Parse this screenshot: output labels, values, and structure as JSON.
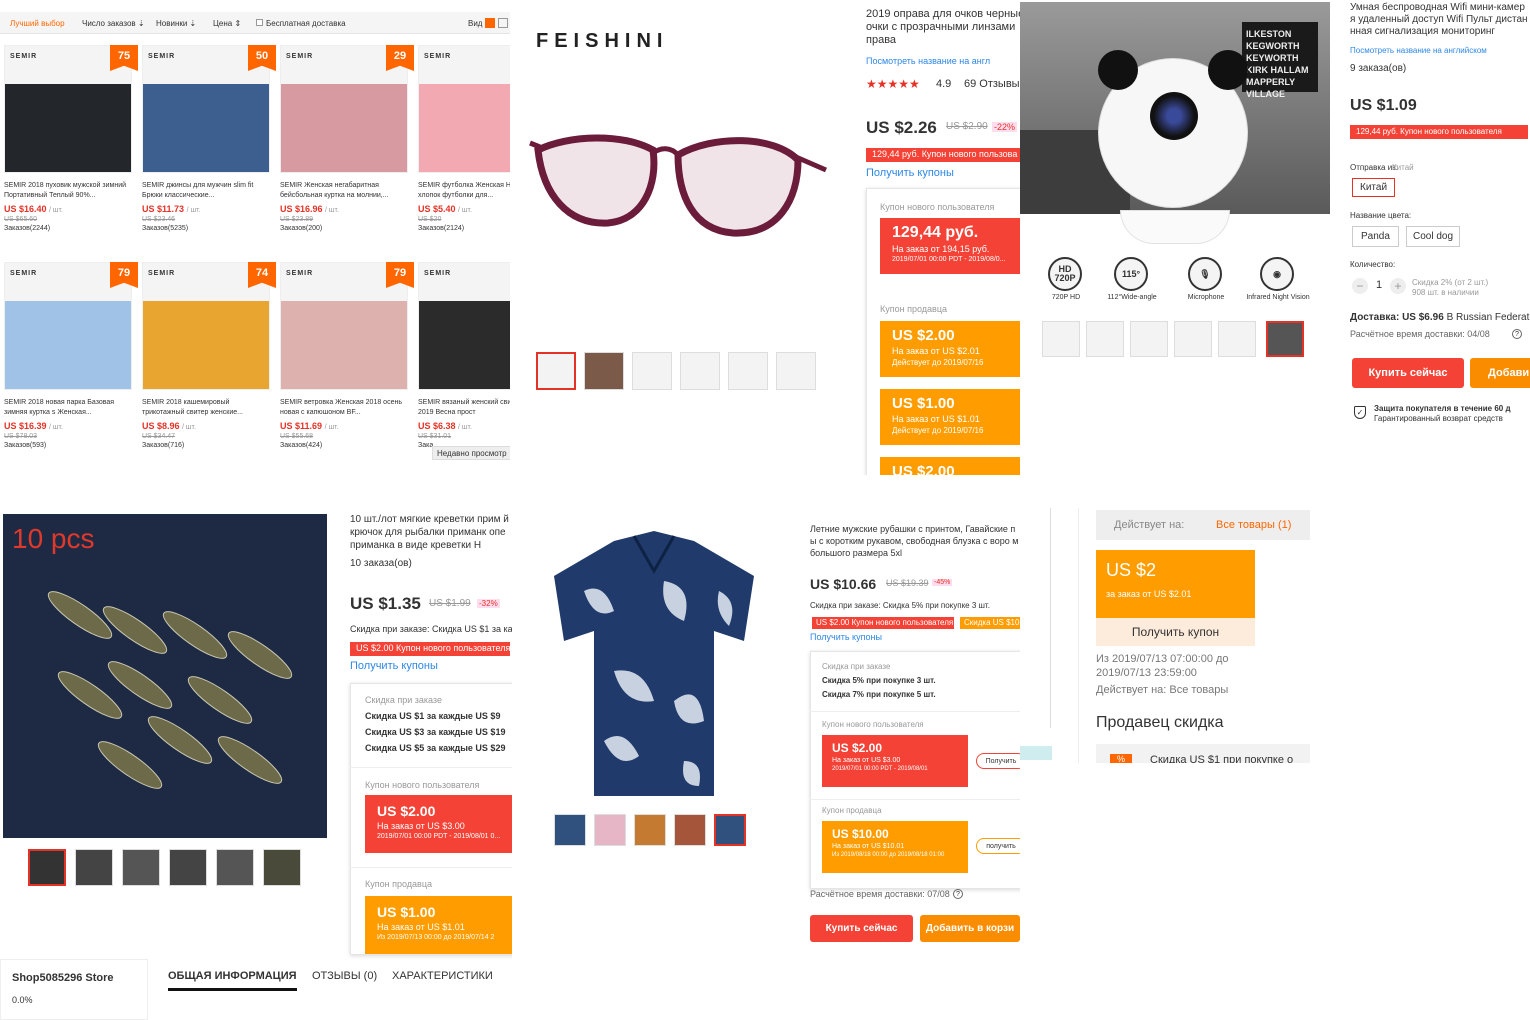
{
  "p1": {
    "sort_tabs": [
      "Лучший выбор",
      "Число заказов ⇣",
      "Новинки ⇣",
      "Цена ⇕"
    ],
    "free_shipping": "Бесплатная доставка",
    "view_label": "Вид",
    "recent": "Недавно просмотр",
    "brand": "SEMIR",
    "products": [
      {
        "badge": "75",
        "title": "SEMIR 2018 пуховик мужской зимний Портативный Теплый 90%...",
        "price": "US $16.40",
        "old": "US $65.60",
        "orders": "Заказов(2244)",
        "img": "#23262b"
      },
      {
        "badge": "50",
        "title": "SEMIR джинсы для мужчин slim fit Брюки классические...",
        "price": "US $11.73",
        "old": "US $23.46",
        "orders": "Заказов(5235)",
        "img": "#3d5f8f"
      },
      {
        "badge": "29",
        "title": "SEMIR Женская негабаритная бейсбольная куртка на молнии,...",
        "price": "US $16.96",
        "old": "US $23.89",
        "orders": "Заказов(200)",
        "img": "#d79aa0"
      },
      {
        "badge": "",
        "title": "SEMIR футболка Женская Ho 100% хлопок футболки для...",
        "price": "US $5.40",
        "old": "US $20",
        "orders": "Заказов(2124)",
        "img": "#f2a9b2"
      },
      {
        "badge": "79",
        "title": "SEMIR 2018 новая парка Базовая зимняя куртка s Женская...",
        "price": "US $16.39",
        "old": "US $78.03",
        "orders": "Заказов(593)",
        "img": "#9fc2e6"
      },
      {
        "badge": "74",
        "title": "SEMIR 2018 кашемировый трикотажный свитер женские...",
        "price": "US $8.96",
        "old": "US $34.47",
        "orders": "Заказов(716)",
        "img": "#e8a530"
      },
      {
        "badge": "79",
        "title": "SEMIR ветровка Женская 2018 осень новая с капюшоном BF...",
        "price": "US $11.69",
        "old": "US $55.68",
        "orders": "Заказов(424)",
        "img": "#dcb1ae"
      },
      {
        "badge": "",
        "title": "SEMIR вязаный женский сви кардиган 2019 Весна прост",
        "price": "US $6.38",
        "old": "US $31.01",
        "orders": "Зака",
        "img": "#2b2b2b"
      }
    ],
    "per_unit": "/ шт."
  },
  "p2": {
    "brand": "FEISHINI",
    "title": "2019 оправа для очков черные очки с прозрачными линзами права",
    "see_en": "Посмотреть название на англ",
    "rating": "4.9",
    "reviews": "69 Отзывы",
    "price": "US $2.26",
    "old": "US $2.90",
    "off": "-22%",
    "coupon_bar": "129,44 руб. Купон нового пользова",
    "get_coupons": "Получить купоны",
    "new_user_label": "Купон нового пользователя",
    "c1_amount": "129,44 руб.",
    "c1_min": "На заказ от 194,15 руб.",
    "c1_date": "2019/07/01 00:00 PDT - 2019/08/0...",
    "seller_label": "Купон продавца",
    "c2_amount": "US $2.00",
    "c2_min": "На заказ от US $2.01",
    "c2_date": "Действует до 2019/07/16",
    "c3_amount": "US $1.00",
    "c3_min": "На заказ от US $1.01",
    "c3_date": "Действует до 2019/07/16",
    "c4_amount": "US $2.00"
  },
  "p3": {
    "art": [
      "ILKESTON",
      "KEGWORTH",
      "KEYWORTH",
      "KIRK HALLAM",
      "MAPPERLY VILLAGE"
    ],
    "features": [
      {
        "icon": "HD 720P",
        "label": "720P HD"
      },
      {
        "icon": "115°",
        "label": "112°Wide-angle"
      },
      {
        "icon": "mic",
        "label": "Microphone"
      },
      {
        "icon": "eye",
        "label": "Infrared Night Vision"
      }
    ]
  },
  "p4": {
    "title": "Умная беспроводная Wifi мини-камер я удаленный доступ Wifi Пульт дистан нная сигнализация мониторинг",
    "see_en": "Посмотреть название на английском",
    "orders": "9 заказа(ов)",
    "price": "US $1.09",
    "coupon_bar": "129,44 руб. Купон нового пользователя",
    "ship_from_label": "Отправка из:",
    "ship_from_value": "Китай",
    "ship_from_option": "Китай",
    "color_label": "Название цвета:",
    "color_options": [
      "Panda",
      "Cool dog"
    ],
    "qty_label": "Количество:",
    "qty": "1",
    "qty_minus": "−",
    "qty_plus": "+",
    "qty_note1": "Скидка 2% (от 2 шт.)",
    "qty_note2": "908 шт. в наличии",
    "delivery": "Доставка:",
    "delivery_price": "US $6.96",
    "delivery_to": "В Russian Federati",
    "est_delivery": "Расчётное время доставки: 04/08",
    "buy_now": "Купить сейчас",
    "add_cart": "Добави",
    "protect1": "Защита покупателя в течение 60 д",
    "protect2": "Гарантированный возврат средств"
  },
  "p5": {
    "overlay": "10 pcs",
    "title": "10 шт./лот мягкие креветки прим й крючок для рыбалки приманк опе приманка в виде креветки H",
    "orders": "10 заказа(ов)",
    "price": "US $1.35",
    "old": "US $1.99",
    "off": "-32%",
    "discount_line": "Скидка при заказе: Скидка US $1 за ка",
    "coupon_bar": "US $2.00 Купон нового пользователя",
    "get_coupons": "Получить купоны",
    "tier_label": "Скидка при заказе",
    "tiers": [
      "Скидка US $1 за каждые US $9",
      "Скидка US $3 за каждые US $19",
      "Скидка US $5 за каждые US $29"
    ],
    "new_user_label": "Купон нового пользователя",
    "c1_amount": "US $2.00",
    "c1_min": "На заказ от US $3.00",
    "c1_date": "2019/07/01 00:00 PDT - 2019/08/01 0...",
    "seller_label": "Купон продавца",
    "c2_amount": "US $1.00",
    "c2_min": "На заказ от US $1.01",
    "c2_date": "Из 2019/07/13 00:00 до 2019/07/14 2",
    "store": "Shop5085296 Store",
    "store_rate": "0.0%",
    "tabs": [
      "ОБЩАЯ ИНФОРМАЦИЯ",
      "ОТЗЫВЫ (0)",
      "ХАРАКТЕРИСТИКИ"
    ]
  },
  "p6": {
    "title": "Летние мужские рубашки с принтом, Гавайские п ы с коротким рукавом, свободная блузка с воро м большого размера 5xl",
    "price": "US $10.66",
    "old": "US $19.39",
    "off": "-45%",
    "discount_line": "Скидка при заказе: Скидка 5% при покупке 3 шт.",
    "coupon_a": "US $2.00 Купон нового пользователя",
    "coupon_b": "Скидка US $10.0",
    "get_coupons": "Получить купоны",
    "tier_label": "Скидка при заказе",
    "tiers": [
      "Скидка 5% при покупке 3 шт.",
      "Скидка 7% при покупке 5 шт."
    ],
    "new_user_label": "Купон нового пользователя",
    "c1_amount": "US $2.00",
    "c1_min": "На заказ от US $3.00",
    "c1_date": "2019/07/01 00:00 PDT - 2019/08/01",
    "c1_btn": "Получить",
    "seller_label": "Купон продавца",
    "c2_amount": "US $10.00",
    "c2_min": "На заказ от US $10.01",
    "c2_date": "Из 2019/08/18 00:00 до 2019/08/18 01:00",
    "c2_btn": "получить",
    "est_delivery": "Расчётное время доставки: 07/08",
    "buy_now": "Купить сейчас",
    "add_cart": "Добавить в корзи"
  },
  "p7": {
    "valid_label": "Действует на:",
    "valid_link": "Все товары (1)",
    "amount": "US $2",
    "min": "за заказ от US $2.01",
    "get": "Получить купон",
    "from": "Из 2019/07/13 07:00:00 до",
    "to": "2019/07/13 23:59:00",
    "applies": "Действует на: Все товары",
    "heading": "Продавец скидка",
    "teaser_icon": "%",
    "teaser": "Скидка US $1 при покупке о"
  }
}
